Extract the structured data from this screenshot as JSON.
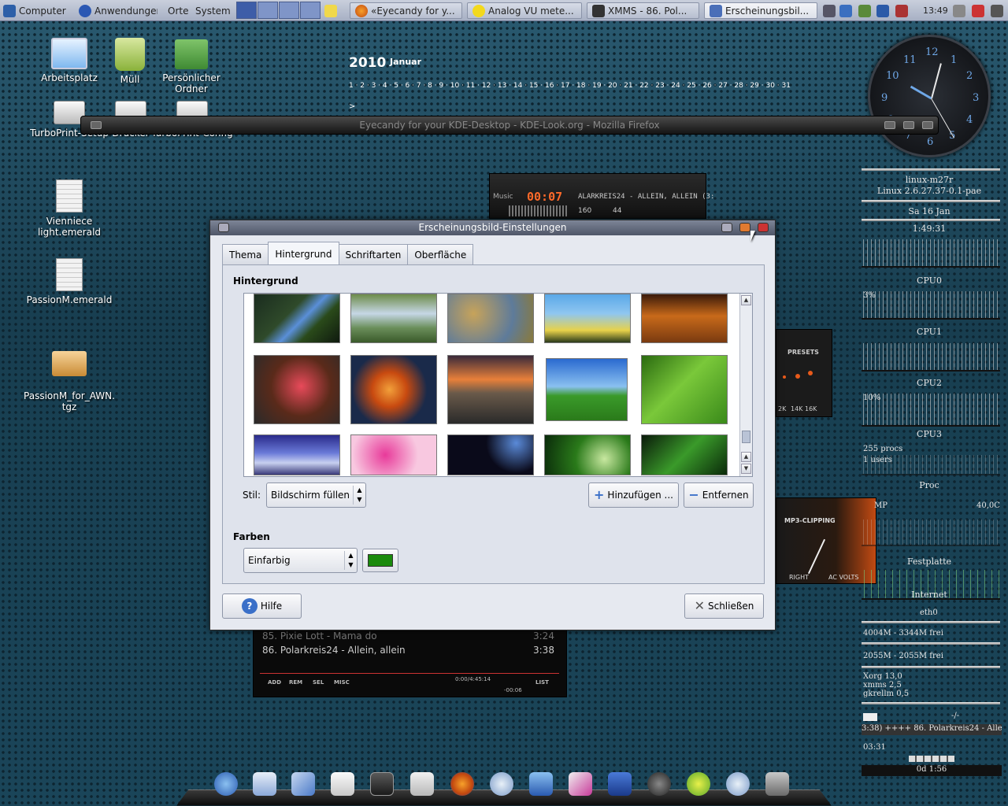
{
  "taskbar": {
    "computer_label": "Computer",
    "apps_label": "Anwendungen",
    "places_label": "Orte",
    "system_label": "System",
    "tasks": [
      {
        "label": "«Eyecandy for y..."
      },
      {
        "label": "Analog VU mete..."
      },
      {
        "label": "XMMS - 86. Pol..."
      },
      {
        "label": "Erscheinungsbil..."
      }
    ],
    "clock": "13:49"
  },
  "desktop": {
    "icons": [
      {
        "label": "Arbeitsplatz"
      },
      {
        "label": "Müll"
      },
      {
        "label": "Persönlicher Ordner"
      },
      {
        "label": "TurboPrint-Setup"
      },
      {
        "label": "Drucker"
      },
      {
        "label": "TurboPrint-Config"
      },
      {
        "label": "Vienniece light.emerald"
      },
      {
        "label": "PassionM.emerald"
      },
      {
        "label": "PassionM_for_AWN.\ntgz"
      }
    ]
  },
  "calendar": {
    "year": "2010",
    "month": "Januar",
    "days": "1 · 2 · 3 · 4 · 5 · 6 · 7 · 8 · 9 · 10 · 11 · 12 · 13 · 14 · 15 · 16 · 17 · 18 · 19 · 20 · 21 · 22 · 23 · 24 · 25 · 26 · 27 · 28 · 29 · 30 · 31",
    "nav": ">"
  },
  "firefox": {
    "title": "Eyecandy for your KDE-Desktop - KDE-Look.org - Mozilla Firefox"
  },
  "clock_widget": {
    "numbers": [
      "12",
      "1",
      "2",
      "3",
      "4",
      "5",
      "6",
      "7",
      "8",
      "9",
      "10",
      "11"
    ]
  },
  "gkrellm": {
    "hostname": "linux-m27r",
    "kernel": "Linux 2.6.27.37-0.1-pae",
    "date": "Sa 16 Jan",
    "uptime": "1:49:31",
    "cpu0": "CPU0",
    "cpu1_pct": "3%",
    "cpu1": "CPU1",
    "cpu2": "CPU2",
    "cpu3_pct": "10%",
    "cpu3": "CPU3",
    "procs": "255 procs",
    "users": "1 users",
    "proc": "Proc",
    "temp_label": "MP",
    "temp_value": "40,0C",
    "disk": "Festplatte",
    "internet": "Internet",
    "eth": "eth0",
    "mem1": "4004M - 3344M frei",
    "mem2": "2055M - 2055M frei",
    "top1": "Xorg 13,0",
    "top2": "xmms 2,5",
    "top3": "gkrellm 0,5",
    "mail": "-/-",
    "song": "3:38) ++++ 86. Polarkreis24 - Allein,",
    "elapsed": "03:31",
    "uptime2": "0d 1:56"
  },
  "xmms": {
    "time": "00:07",
    "label": "Music",
    "scroll": "ALARKREIS24 - ALLEIN, ALLEIN (3:",
    "kbps": "160",
    "khz": "44",
    "presets": "PRESETS",
    "eq_bands": [
      "2K",
      "14K",
      "16K"
    ],
    "vu_title": "MP3-CLIPPING",
    "vu_right": "RIGHT",
    "vu_ac": "AC VOLTS",
    "playlist": [
      {
        "title": "85. Pixie Lott - Mama do",
        "time": "3:24"
      },
      {
        "title": "86. Polarkreis24 - Allein, allein",
        "time": "3:38"
      }
    ],
    "pl_buttons": [
      "ADD",
      "REM",
      "SEL",
      "MISC"
    ],
    "pl_time": "0:00/4:45:14",
    "pl_remaining": "-00:06",
    "pl_list": "LIST"
  },
  "dialog": {
    "title": "Erscheinungsbild-Einstellungen",
    "tabs": [
      {
        "label": "Thema"
      },
      {
        "label": "Hintergrund"
      },
      {
        "label": "Schriftarten"
      },
      {
        "label": "Oberfläche"
      }
    ],
    "background_section": "Hintergrund",
    "style_label": "Stil:",
    "style_value": "Bildschirm füllen",
    "add_button": "Hinzufügen ...",
    "remove_button": "Entfernen",
    "colors_section": "Farben",
    "color_mode": "Einfarbig",
    "color_value": "#1a8a0c",
    "help_button": "Hilfe",
    "close_button": "Schließen"
  },
  "colors": {
    "dialog_bg": "#e6e9f0",
    "titlebar": "#5a6275",
    "selected_swatch": "#1a8a0c"
  }
}
